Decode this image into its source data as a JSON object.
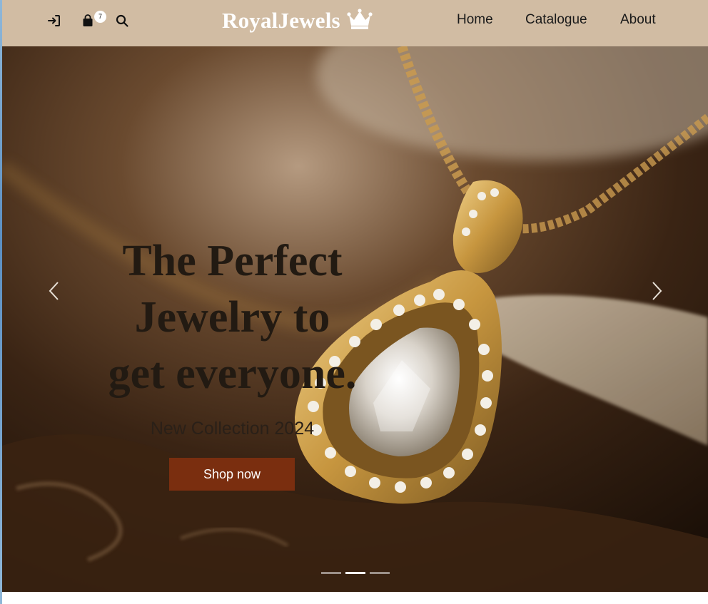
{
  "navbar": {
    "brand": "RoyalJewels",
    "cart_count": "7",
    "links": [
      {
        "label": "Home"
      },
      {
        "label": "Catalogue"
      },
      {
        "label": "About"
      }
    ],
    "icons": [
      "login-icon",
      "shopping-bag-icon",
      "search-icon",
      "crown-icon"
    ],
    "background_color": "#d1bca3"
  },
  "hero": {
    "title": "The Perfect Jewelry to get everyone.",
    "subtitle": "New Collection 2024",
    "cta_label": "Shop now",
    "cta_color": "#7a2e0f",
    "slides_count": 3,
    "active_slide": 2,
    "controls": [
      "chevron-left-icon",
      "chevron-right-icon"
    ]
  }
}
